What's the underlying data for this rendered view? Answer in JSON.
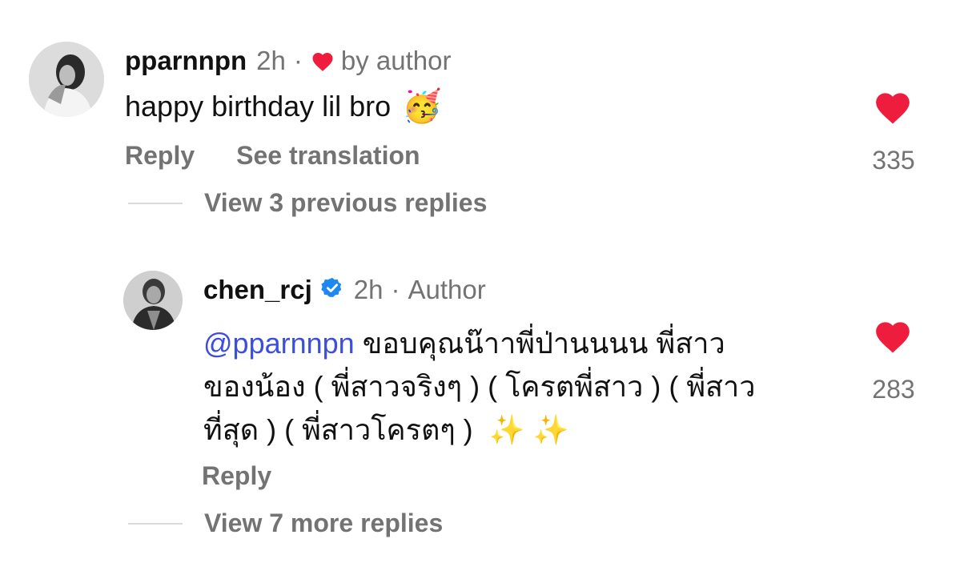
{
  "comment": {
    "username": "pparnnpn",
    "time": "2h",
    "separator": "·",
    "liked_by_author_label": "by author",
    "text": "happy birthday lil bro",
    "emoji": "🥳",
    "reply_label": "Reply",
    "see_translation_label": "See translation",
    "like_count": "335",
    "liked": true
  },
  "previous_replies_label": "View 3 previous replies",
  "reply": {
    "username": "chen_rcj",
    "verified": true,
    "time": "2h",
    "separator": "·",
    "author_label": "Author",
    "mention": "@pparnnpn",
    "line1": " ขอบคุณน๊าาพี่ป่านนนน พี่สาว",
    "line2": "ของน้อง ( พี่สาวจริงๆ ) ( โครตพี่สาว ) ( พี่สาว",
    "line3": "ที่สุด ) ( พี่สาวโครตๆ ) ",
    "emoji": "✨ ✨",
    "reply_label": "Reply",
    "like_count": "283",
    "liked": true
  },
  "more_replies_label": "View 7 more replies",
  "colors": {
    "heart": "#ee1d3e",
    "mention": "#3b4ee0",
    "verified": "#1e88f0",
    "muted": "#737373"
  }
}
